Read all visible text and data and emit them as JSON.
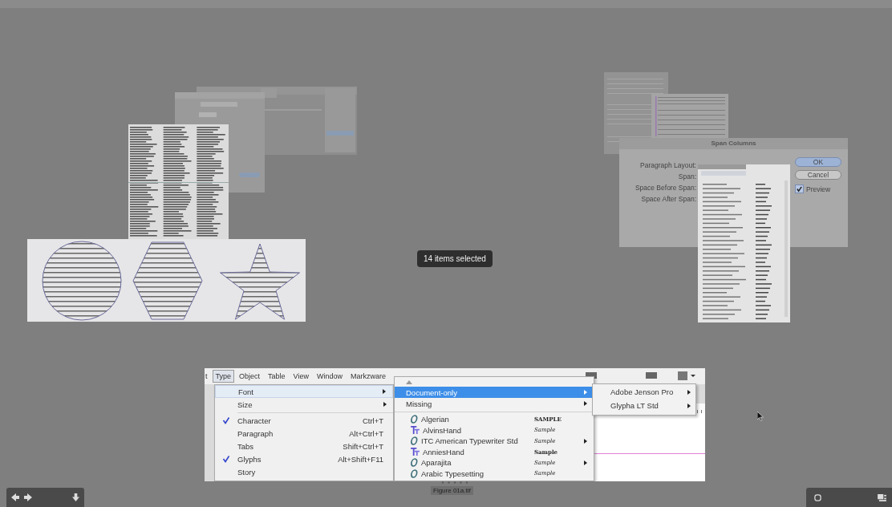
{
  "viewer": {
    "selection_badge": "14 items selected",
    "file_name": "Figure 01a.tif"
  },
  "span_dialog": {
    "title": "Span Columns",
    "fields": [
      "Paragraph Layout:",
      "Span:",
      "Space Before Span:",
      "Space After Span:"
    ],
    "buttons": [
      {
        "label": "OK",
        "default": true
      },
      {
        "label": "Cancel",
        "default": false
      }
    ],
    "preview": {
      "label": "Preview",
      "checked": true
    }
  },
  "menu_screenshot": {
    "menubar": [
      {
        "label": "t",
        "selected": false
      },
      {
        "label": "Type",
        "selected": true
      },
      {
        "label": "Object",
        "selected": false
      },
      {
        "label": "Table",
        "selected": false
      },
      {
        "label": "View",
        "selected": false
      },
      {
        "label": "Window",
        "selected": false
      },
      {
        "label": "Markzware",
        "selected": false
      }
    ],
    "type_menu": [
      {
        "label": "Font",
        "checked": false,
        "submenu": true,
        "highlighted": true,
        "separator_after": false
      },
      {
        "label": "Size",
        "checked": false,
        "submenu": true,
        "highlighted": false,
        "separator_after": true
      },
      {
        "label": "Character",
        "checked": true,
        "shortcut": "Ctrl+T",
        "submenu": false,
        "highlighted": false,
        "separator_after": false
      },
      {
        "label": "Paragraph",
        "checked": false,
        "shortcut": "Alt+Ctrl+T",
        "submenu": false,
        "highlighted": false,
        "separator_after": false
      },
      {
        "label": "Tabs",
        "checked": false,
        "shortcut": "Shift+Ctrl+T",
        "submenu": false,
        "highlighted": false,
        "separator_after": false
      },
      {
        "label": "Glyphs",
        "checked": true,
        "shortcut": "Alt+Shift+F11",
        "submenu": false,
        "highlighted": false,
        "separator_after": false
      },
      {
        "label": "Story",
        "checked": false,
        "submenu": false,
        "highlighted": false,
        "separator_after": false
      }
    ],
    "font_menu": {
      "categories": [
        {
          "label": "Document-only",
          "selected": true
        },
        {
          "label": "Missing",
          "selected": false
        }
      ],
      "fonts": [
        {
          "name": "Algerian",
          "kind": "opentype",
          "sample": "SAMPLE",
          "submenu": false
        },
        {
          "name": "AlvinsHand",
          "kind": "truetype",
          "sample": "Sample",
          "submenu": false
        },
        {
          "name": "ITC American Typewriter Std",
          "kind": "opentype",
          "sample": "Sample",
          "submenu": true
        },
        {
          "name": "AnniesHand",
          "kind": "truetype",
          "sample": "Sample",
          "submenu": false
        },
        {
          "name": "Aparajita",
          "kind": "opentype",
          "sample": "Sample",
          "submenu": true
        },
        {
          "name": "Arabic Typesetting",
          "kind": "opentype",
          "sample": "Sample",
          "submenu": false
        }
      ]
    },
    "document_only_menu": [
      {
        "label": "Adobe Jenson Pro",
        "submenu": true
      },
      {
        "label": "Glypha LT Std",
        "submenu": true
      }
    ]
  }
}
